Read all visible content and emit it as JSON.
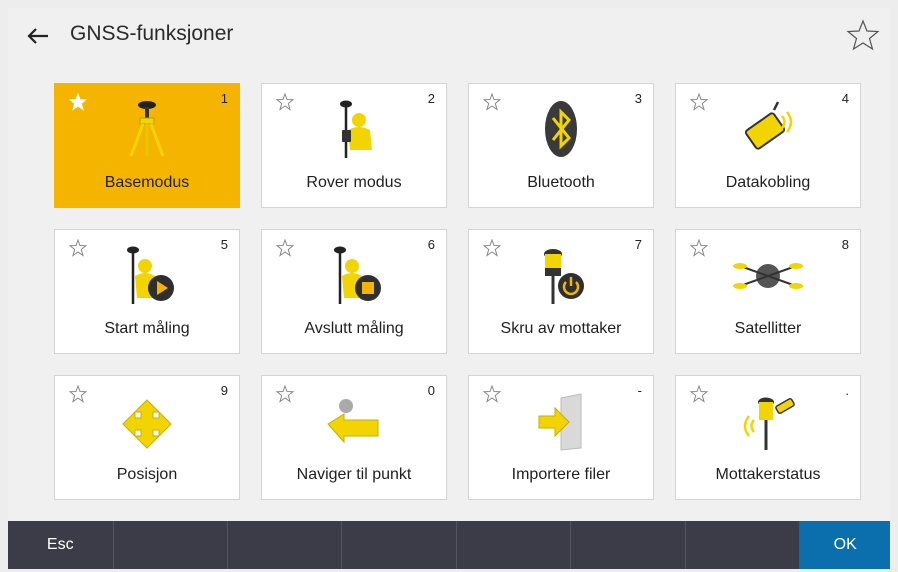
{
  "header": {
    "title": "GNSS-funksjoner",
    "back_icon": "arrow-left-icon",
    "favorite_icon": "star-outline-icon"
  },
  "colors": {
    "selected_tile": "#f5b400",
    "ok_button": "#0b6ead",
    "bottom_bar": "#3c3c48",
    "icon_yellow": "#f2d500"
  },
  "tiles": [
    {
      "label": "Basemodus",
      "key": "1",
      "icon": "tripod-base-icon",
      "selected": true
    },
    {
      "label": "Rover modus",
      "key": "2",
      "icon": "rover-surveyor-icon",
      "selected": false
    },
    {
      "label": "Bluetooth",
      "key": "3",
      "icon": "bluetooth-icon",
      "selected": false
    },
    {
      "label": "Datakobling",
      "key": "4",
      "icon": "data-link-icon",
      "selected": false
    },
    {
      "label": "Start måling",
      "key": "5",
      "icon": "start-survey-icon",
      "selected": false
    },
    {
      "label": "Avslutt måling",
      "key": "6",
      "icon": "end-survey-icon",
      "selected": false
    },
    {
      "label": "Skru av mottaker",
      "key": "7",
      "icon": "receiver-power-icon",
      "selected": false
    },
    {
      "label": "Satellitter",
      "key": "8",
      "icon": "satellite-icon",
      "selected": false
    },
    {
      "label": "Posisjon",
      "key": "9",
      "icon": "position-arrows-icon",
      "selected": false
    },
    {
      "label": "Naviger til punkt",
      "key": "0",
      "icon": "navigate-to-point-icon",
      "selected": false
    },
    {
      "label": "Importere filer",
      "key": "-",
      "icon": "import-files-icon",
      "selected": false
    },
    {
      "label": "Mottakerstatus",
      "key": ".",
      "icon": "receiver-status-icon",
      "selected": false
    }
  ],
  "bottom_bar": {
    "esc_label": "Esc",
    "ok_label": "OK"
  }
}
